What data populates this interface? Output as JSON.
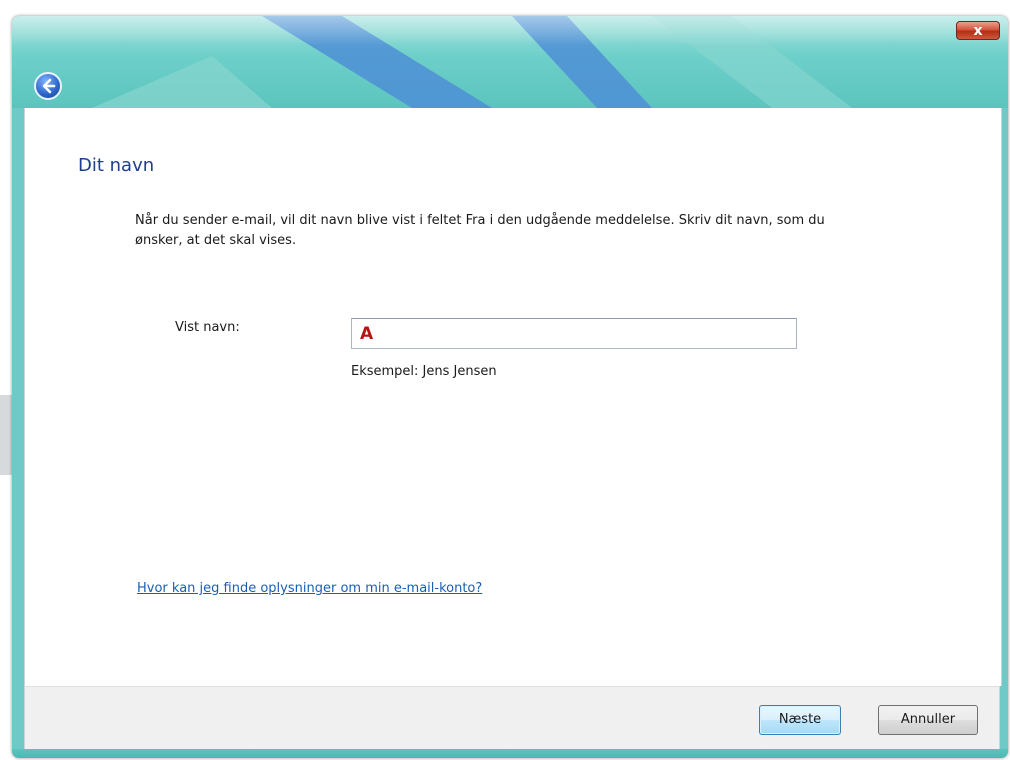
{
  "window": {
    "close_label": "x"
  },
  "page": {
    "heading": "Dit navn",
    "description": "Når du sender e-mail, vil dit navn blive vist i feltet Fra i den udgående meddelelse. Skriv dit navn, som du ønsker, at det skal vises."
  },
  "form": {
    "display_name_label": "Vist navn:",
    "display_name_value": "A",
    "example_text": "Eksempel: Jens Jensen"
  },
  "help_link": "Hvor kan jeg finde oplysninger om min e-mail-konto?",
  "buttons": {
    "next": "Næste",
    "cancel": "Annuller"
  },
  "icons": {
    "back": "back-arrow-icon",
    "close": "close-icon"
  },
  "colors": {
    "titlebar": "#6dcfc9",
    "heading": "#1e3f8c",
    "link": "#1a5fb4",
    "input_text": "#b01815",
    "close_button": "#c8452c"
  }
}
